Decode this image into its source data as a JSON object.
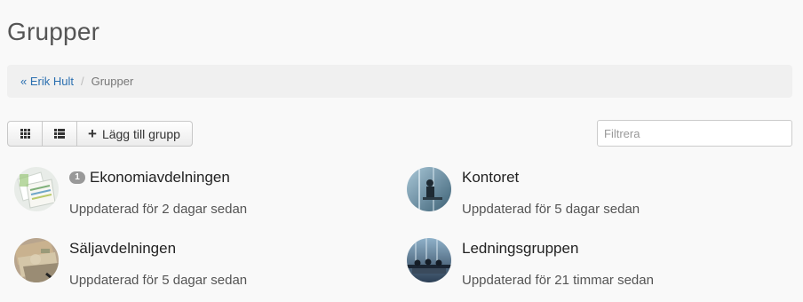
{
  "page": {
    "title": "Grupper"
  },
  "breadcrumb": {
    "parent": "« Erik Hult",
    "separator": "/",
    "current": "Grupper"
  },
  "toolbar": {
    "grid_icon": "grid-view-icon",
    "list_icon": "list-view-icon",
    "add_icon": "plus-icon",
    "add_label": "Lägg till grupp"
  },
  "filter": {
    "placeholder": "Filtrera",
    "value": ""
  },
  "groups": [
    {
      "name": "Ekonomiavdelningen",
      "badge": "1",
      "updated": "Uppdaterad för 2 dagar sedan",
      "icon": "finance-documents-image"
    },
    {
      "name": "Kontoret",
      "badge": "",
      "updated": "Uppdaterad för 5 dagar sedan",
      "icon": "office-window-image"
    },
    {
      "name": "Säljavdelningen",
      "badge": "",
      "updated": "Uppdaterad för 5 dagar sedan",
      "icon": "banknotes-image"
    },
    {
      "name": "Ledningsgruppen",
      "badge": "",
      "updated": "Uppdaterad för 21 timmar sedan",
      "icon": "meeting-room-image"
    }
  ]
}
